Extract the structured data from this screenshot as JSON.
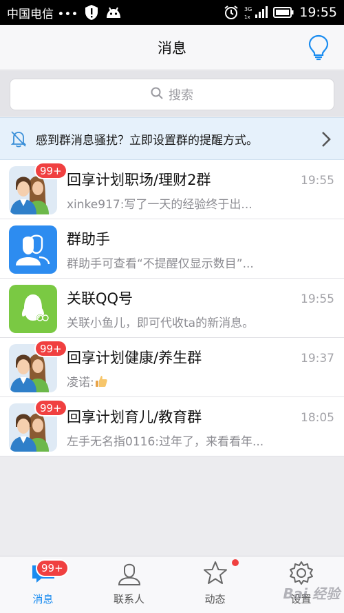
{
  "status_bar": {
    "carrier": "中国电信 •••",
    "network": "3G",
    "time": "19:55"
  },
  "header": {
    "title": "消息",
    "right_icon": "lightbulb-icon"
  },
  "search": {
    "placeholder": "搜索"
  },
  "banner": {
    "text": "感到群消息骚扰？立即设置群的提醒方式。"
  },
  "conversations": [
    {
      "title": "回享计划职场/理财2群",
      "time": "19:55",
      "preview": "xinke917:写了一天的经验终于出...",
      "badge": "99+",
      "avatar": "group-couple-avatar"
    },
    {
      "title": "群助手",
      "time": "",
      "preview": "群助手可查看“不提醒仅显示数目”...",
      "badge": "",
      "avatar": "group-assistant-avatar"
    },
    {
      "title": "关联QQ号",
      "time": "19:55",
      "preview": "关联小鱼儿，即可代收ta的新消息。",
      "badge": "",
      "avatar": "linked-qq-avatar"
    },
    {
      "title": "回享计划健康/养生群",
      "time": "19:37",
      "preview": "凌诺:",
      "badge": "99+",
      "avatar": "group-couple-avatar"
    },
    {
      "title": "回享计划育儿/教育群",
      "time": "18:05",
      "preview": "左手无名指0116:过年了，来看看年...",
      "badge": "99+",
      "avatar": "group-couple-avatar"
    }
  ],
  "tabs": [
    {
      "label": "消息",
      "badge": "99+",
      "icon": "message-icon",
      "active": true
    },
    {
      "label": "联系人",
      "badge": "",
      "icon": "contacts-icon",
      "active": false
    },
    {
      "label": "动态",
      "badge": "",
      "icon": "star-icon",
      "active": false
    },
    {
      "label": "设置",
      "badge": "",
      "icon": "gear-icon",
      "active": false
    }
  ],
  "watermark": "Bai 经验",
  "colors": {
    "accent": "#1a8cf0",
    "badge": "#f04040",
    "banner_bg": "#e6f1fb",
    "qq_green": "#7ac943",
    "assistant_blue": "#2d8cf0"
  }
}
